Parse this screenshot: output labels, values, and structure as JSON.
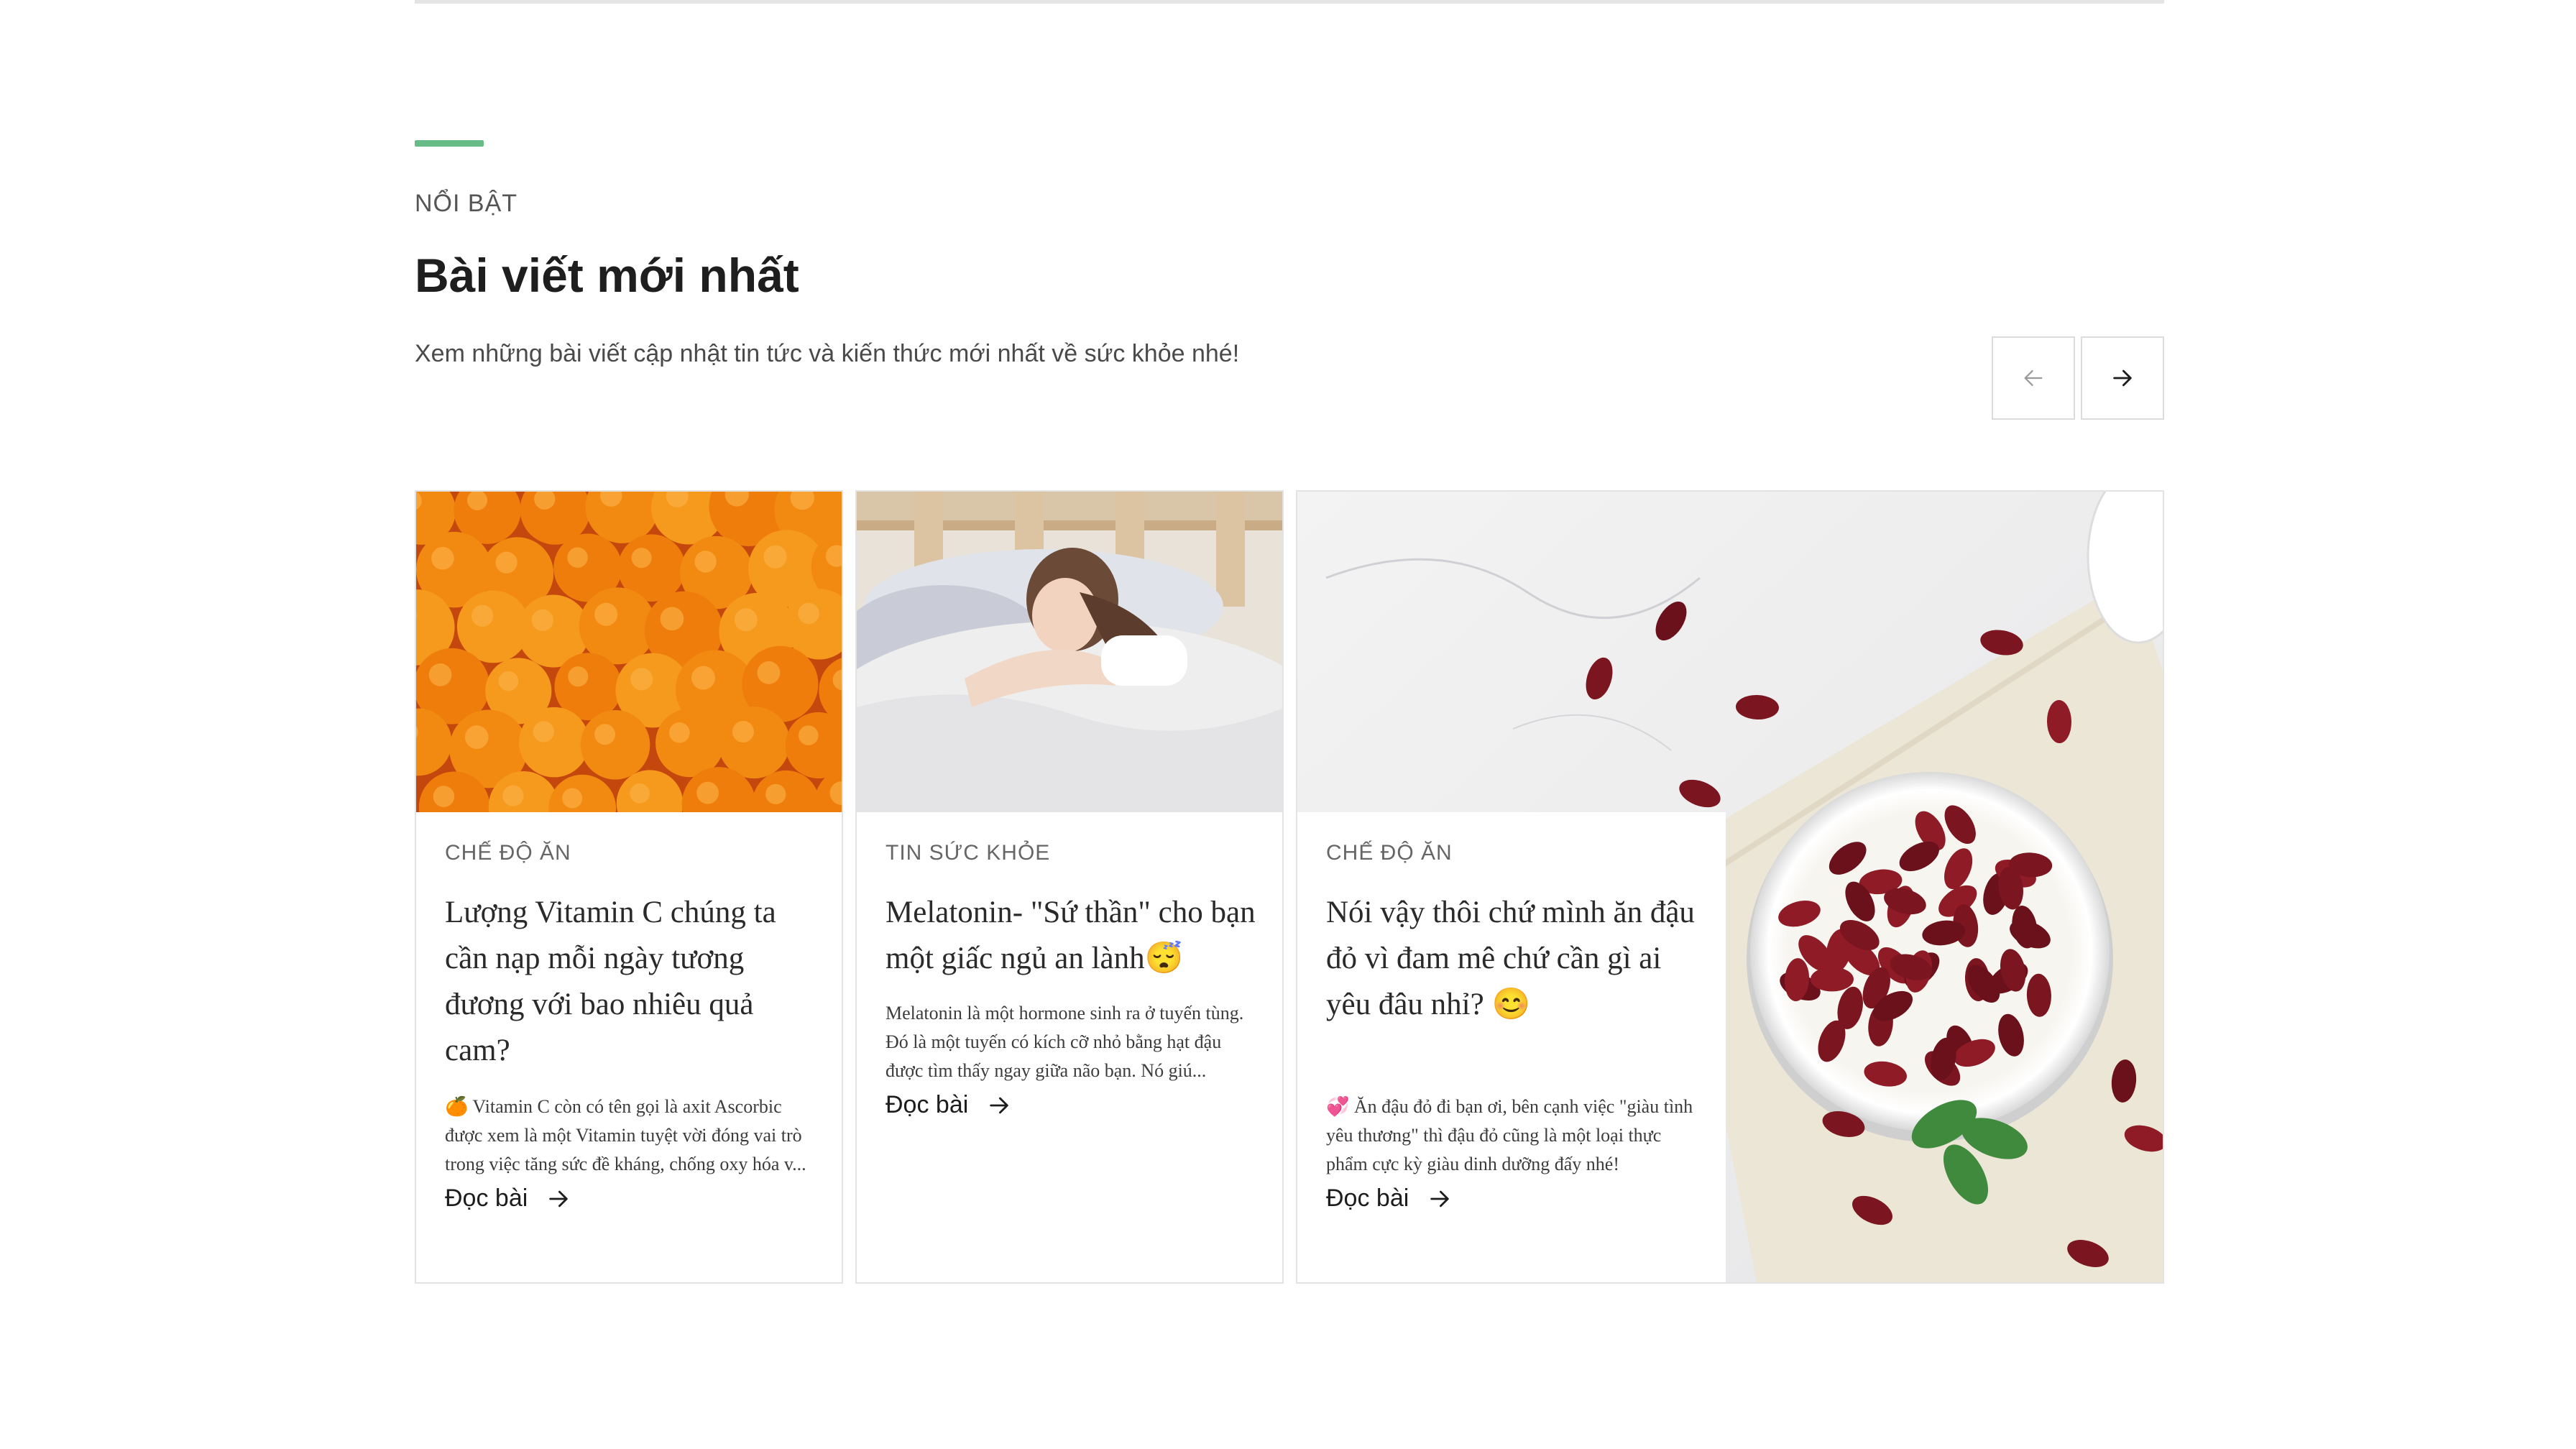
{
  "section": {
    "eyebrow": "NỔI BẬT",
    "title": "Bài viết mới nhất",
    "subtitle": "Xem những bài viết cập nhật tin tức và kiến thức mới nhất về sức khỏe nhé!",
    "accent_color": "#66bb86"
  },
  "nav": {
    "prev_icon": "arrow-left-icon",
    "next_icon": "arrow-right-icon"
  },
  "cards": [
    {
      "category": "CHẾ ĐỘ ĂN",
      "title": "Lượng Vitamin C chúng ta cần nạp mỗi ngày tương đương với bao nhiêu quả cam?",
      "excerpt": "🍊 Vitamin C còn có tên gọi là axit Ascorbic được xem là một Vitamin tuyệt vời đóng vai trò trong việc tăng sức đề kháng, chống oxy hóa v...",
      "read_more": "Đọc bài",
      "image": "oranges-photo"
    },
    {
      "category": "TIN SỨC KHỎE",
      "title": "Melatonin- \"Sứ thần\" cho bạn một giấc ngủ an lành😴",
      "excerpt": "Melatonin là một hormone sinh ra ở tuyến tùng. Đó là một tuyến có kích cỡ nhỏ bằng hạt đậu được tìm thấy ngay giữa não bạn. Nó giú...",
      "read_more": "Đọc bài",
      "image": "sleeping-woman-photo"
    },
    {
      "category": "CHẾ ĐỘ ĂN",
      "title": "Nói vậy thôi chứ mình ăn đậu đỏ vì đam mê chứ cần gì ai yêu đâu nhỉ? 😊",
      "excerpt": "💞 Ăn đậu đỏ đi bạn ơi, bên cạnh việc \"giàu tình yêu thương\" thì đậu đỏ cũng là một loại thực phẩm cực kỳ giàu dinh dưỡng đấy nhé!",
      "read_more": "Đọc bài",
      "image": "red-beans-photo"
    }
  ]
}
